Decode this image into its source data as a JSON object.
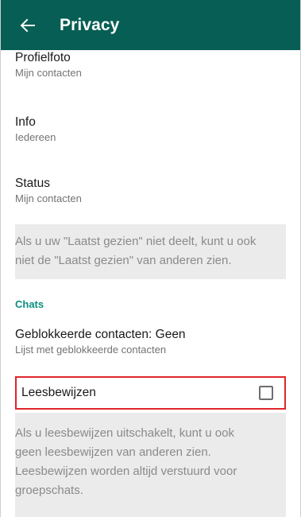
{
  "appbar": {
    "title": "Privacy",
    "back_icon": "arrow-left-icon"
  },
  "settings": [
    {
      "title": "Profielfoto",
      "subtitle": "Mijn contacten"
    },
    {
      "title": "Info",
      "subtitle": "Iedereen"
    },
    {
      "title": "Status",
      "subtitle": "Mijn contacten"
    }
  ],
  "last_seen_note": {
    "line1": "Als u uw \"Laatst gezien\" niet deelt, kunt u ook",
    "line2": "niet de \"Laatst gezien\" van anderen zien."
  },
  "chats": {
    "header": "Chats",
    "blocked_title": "Geblokkeerde contacten: Geen",
    "blocked_subtitle": "Lijst met geblokkeerde contacten",
    "read_receipts_label": "Leesbewijzen",
    "read_receipts_checked": false
  },
  "read_receipts_note": {
    "line1": "Als u leesbewijzen uitschakelt, kunt u ook",
    "line2": "geen leesbewijzen van anderen zien.",
    "line3": "Leesbewijzen worden altijd verstuurd voor",
    "line4": "groepschats."
  },
  "colors": {
    "appbar": "#075e54",
    "accent": "#0b8f7f",
    "highlight_border": "#e0252b",
    "note_background": "#ebebeb"
  }
}
